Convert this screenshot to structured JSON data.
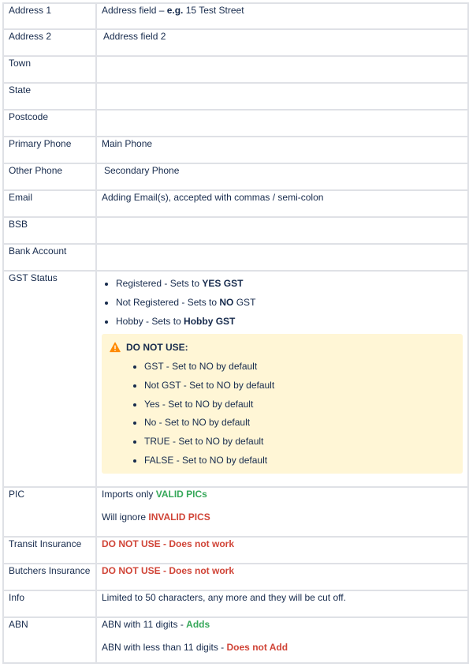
{
  "rows": {
    "address1": {
      "label": "Address 1",
      "prefix": "Address field – ",
      "bold": "e.g.",
      "suffix": " 15 Test Street"
    },
    "address2": {
      "label": "Address 2",
      "value": "Address field 2"
    },
    "town": {
      "label": "Town",
      "value": ""
    },
    "state": {
      "label": "State",
      "value": ""
    },
    "postcode": {
      "label": "Postcode",
      "value": ""
    },
    "primary_phone": {
      "label": "Primary Phone",
      "value": "Main Phone"
    },
    "other_phone": {
      "label": "Other Phone",
      "value": "Secondary Phone"
    },
    "email": {
      "label": "Email",
      "value": "Adding Email(s), accepted with commas / semi-colon"
    },
    "bsb": {
      "label": "BSB",
      "value": ""
    },
    "bank_account": {
      "label": "Bank Account",
      "value": ""
    },
    "gst": {
      "label": "GST Status",
      "items": [
        {
          "text": "Registered - Sets to ",
          "bold": "YES GST"
        },
        {
          "text": "Not Registered - Sets to ",
          "bold": "NO",
          "tail": " GST"
        },
        {
          "text": "Hobby - Sets to ",
          "bold": "Hobby GST"
        }
      ],
      "warning": {
        "icon": "warning-icon",
        "title": "DO NOT USE:",
        "items": [
          "GST - Set to NO by default",
          "Not GST - Set to NO by default",
          "Yes - Set to NO by default",
          "No - Set to NO by default",
          "TRUE - Set to NO by default",
          "FALSE - Set to NO by default"
        ],
        "bg_color": "#fff6d6",
        "icon_color": "#ff8b00"
      }
    },
    "pic": {
      "label": "PIC",
      "line1_prefix": "Imports only ",
      "line1_highlight": "VALID PICs",
      "line2_prefix": "Will ignore ",
      "line2_highlight": "INVALID PICS"
    },
    "transit_insurance": {
      "label": "Transit Insurance",
      "value": "DO NOT USE - Does not work"
    },
    "butchers_insurance": {
      "label": "Butchers Insurance",
      "value": "DO NOT USE - Does not work"
    },
    "info": {
      "label": "Info",
      "value": "Limited to 50 characters, any more and they will be cut off."
    },
    "abn": {
      "label": "ABN",
      "line1_prefix": "ABN with 11 digits - ",
      "line1_highlight": "Adds",
      "line2_prefix": "ABN with less than 11 digits - ",
      "line2_highlight": "Does not Add"
    }
  },
  "colors": {
    "green": "#36a85a",
    "red": "#d04437",
    "border": "#dfe1e6",
    "text": "#172b4d"
  }
}
